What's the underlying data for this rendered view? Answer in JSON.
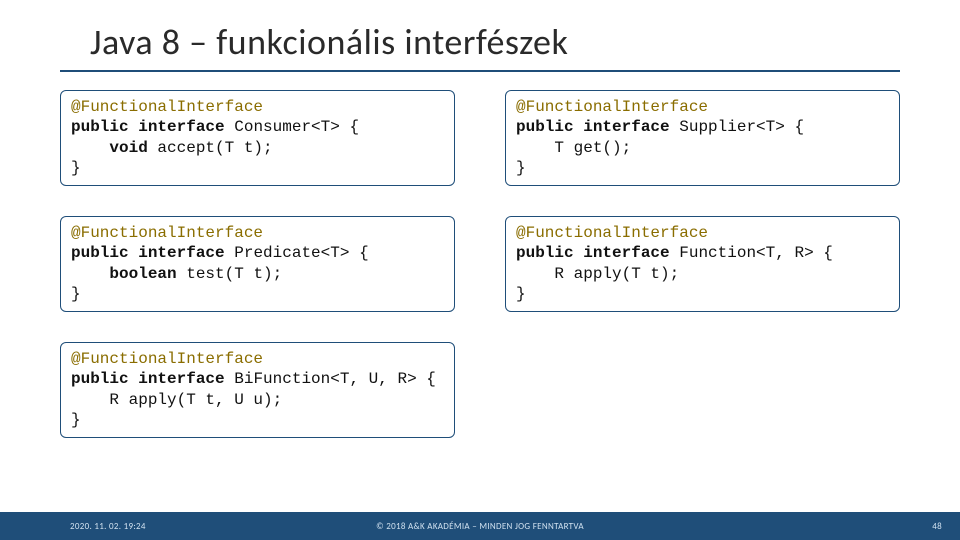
{
  "title": "Java 8 – funkcionális interfészek",
  "code": {
    "consumer": "@FunctionalInterface\npublic interface Consumer<T> {\n    void accept(T t);\n}",
    "supplier": "@FunctionalInterface\npublic interface Supplier<T> {\n    T get();\n}",
    "predicate": "@FunctionalInterface\npublic interface Predicate<T> {\n    boolean test(T t);\n}",
    "function": "@FunctionalInterface\npublic interface Function<T, R> {\n    R apply(T t);\n}",
    "bifunction": "@FunctionalInterface\npublic interface BiFunction<T, U, R> {\n    R apply(T t, U u);\n}"
  },
  "footer": {
    "timestamp": "2020. 11. 02. 19:24",
    "copyright": "© 2018 A&K AKADÉMIA – MINDEN JOG FENNTARTVA",
    "page": "48"
  }
}
